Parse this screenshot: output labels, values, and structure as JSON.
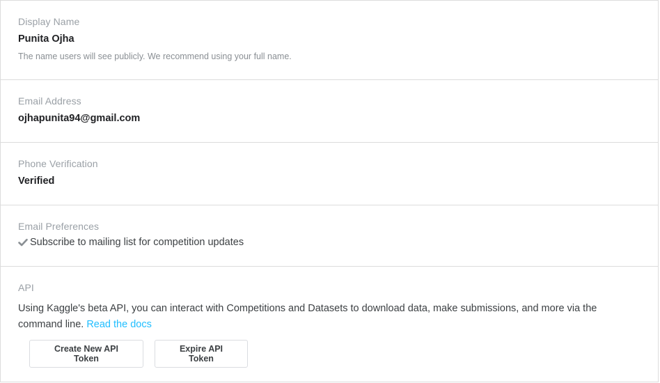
{
  "display_name": {
    "label": "Display Name",
    "value": "Punita Ojha",
    "hint": "The name users will see publicly. We recommend using your full name."
  },
  "email": {
    "label": "Email Address",
    "value": "ojhapunita94@gmail.com"
  },
  "phone": {
    "label": "Phone Verification",
    "value": "Verified"
  },
  "email_preferences": {
    "label": "Email Preferences",
    "items": [
      {
        "icon": "checkmark-icon",
        "label": "Subscribe to mailing list for competition updates",
        "checked": true
      }
    ]
  },
  "api": {
    "label": "API",
    "description": "Using Kaggle's beta API, you can interact with Competitions and Datasets to download data, make submissions, and more via the command line.",
    "link_text": "Read the docs",
    "buttons": {
      "create": "Create New API Token",
      "expire": "Expire API Token"
    }
  },
  "colors": {
    "link": "#20beff",
    "label": "#9aa0a6",
    "border": "#dcdcdc"
  }
}
